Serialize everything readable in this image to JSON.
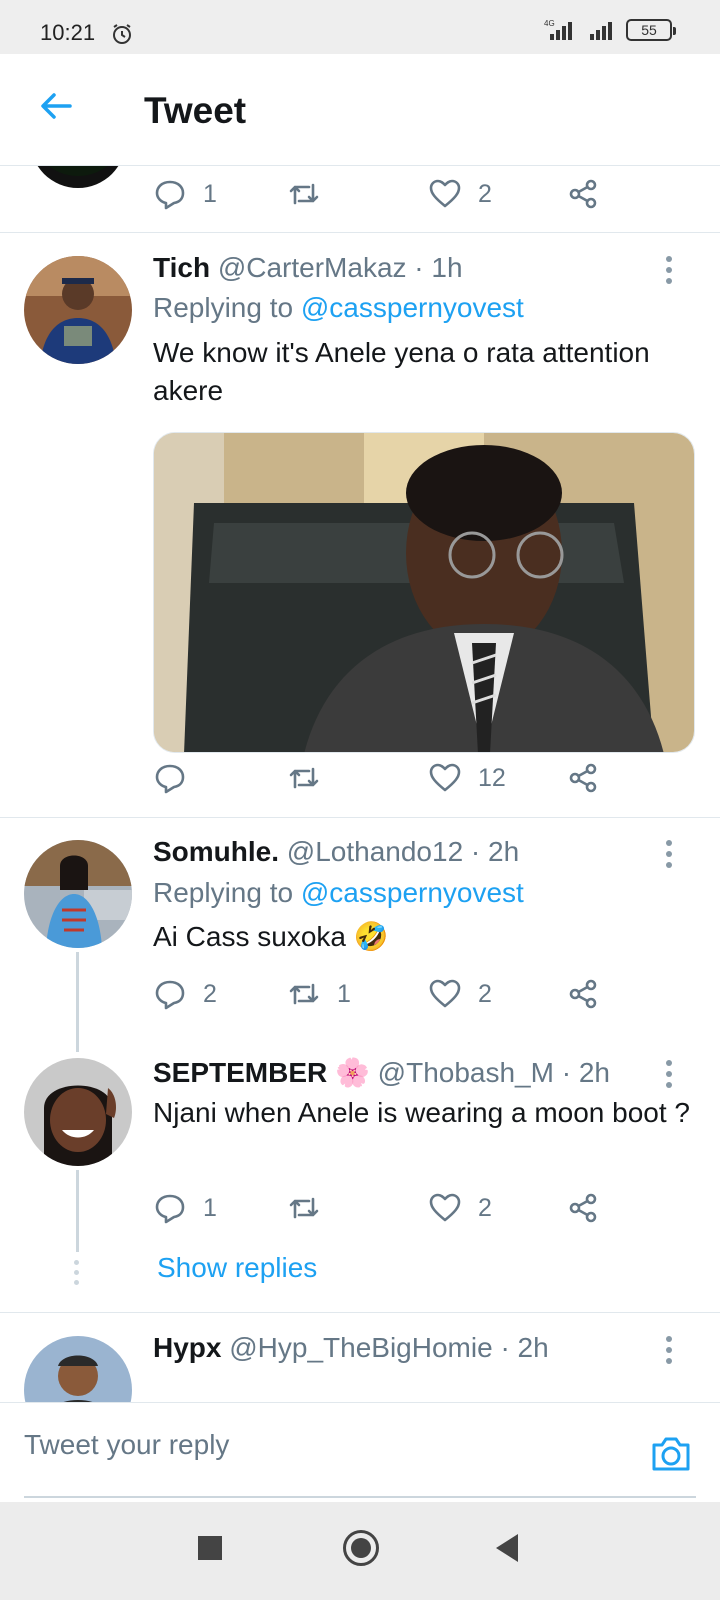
{
  "status_bar": {
    "time": "10:21",
    "network": "4G",
    "battery": "55"
  },
  "header": {
    "title": "Tweet"
  },
  "top_actions": {
    "reply_count": "1",
    "retweet_count": "",
    "like_count": "2"
  },
  "tweets": [
    {
      "display_name": "Tich",
      "handle_time": "@CarterMakaz · 1h",
      "replying_prefix": "Replying to ",
      "replying_to": "@casspernyovest",
      "text": "We know it's Anele yena o rata attention akere",
      "reply_count": "",
      "retweet_count": "",
      "like_count": "12"
    },
    {
      "display_name": "Somuhle.",
      "handle_time": "@Lothando12 · 2h",
      "replying_prefix": "Replying to ",
      "replying_to": "@casspernyovest",
      "text": "Ai Cass suxoka 🤣",
      "reply_count": "2",
      "retweet_count": "1",
      "like_count": "2"
    },
    {
      "display_name": "SEPTEMBER 🌸",
      "handle_time": "@Thobash_M · 2h",
      "text": "Njani when Anele is wearing a moon boot ?",
      "reply_count": "1",
      "retweet_count": "",
      "like_count": "2"
    },
    {
      "display_name": "Hypx",
      "handle_time": "@Hyp_TheBigHomie · 2h"
    }
  ],
  "thread": {
    "show_replies": "Show replies"
  },
  "reply_bar": {
    "placeholder": "Tweet your reply"
  },
  "colors": {
    "accent": "#1da1f2",
    "secondary_text": "#657786",
    "divider": "#e1e8ed"
  }
}
